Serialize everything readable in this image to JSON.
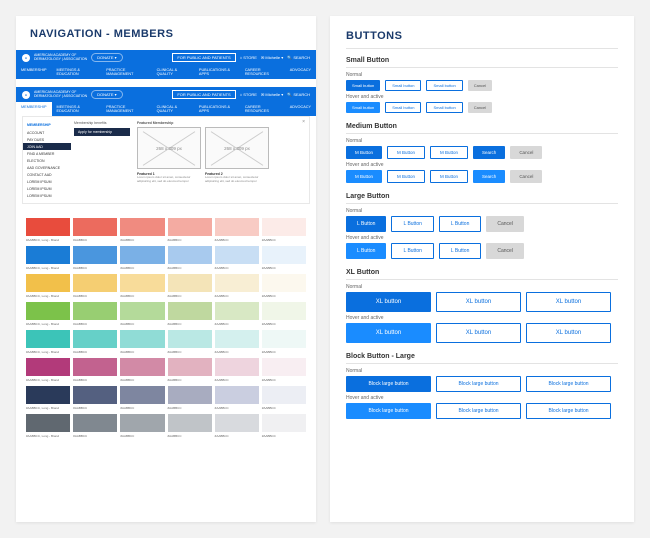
{
  "left_title": "NAVIGATION - MEMBERS",
  "right_title": "BUTTONS",
  "nav": {
    "brand1": "AMERICAN ACADEMY OF",
    "brand2": "DERMATOLOGY | ASSOCIATION",
    "donate": "DONATE ▾",
    "public": "FOR PUBLIC AND PATIENTS",
    "store": "⌂ STORE",
    "member": "✉ Michelle ▾",
    "search": "🔍 SEARCH",
    "items": [
      "MEMBERSHIP",
      "MEETINGS & EDUCATION",
      "PRACTICE MANAGEMENT",
      "CLINICAL & QUALITY",
      "PUBLICATIONS & APPS",
      "CAREER RESOURCES",
      "ADVOCACY"
    ]
  },
  "mega": {
    "header": "MEMBERSHIP",
    "items": [
      "ACCOUNT",
      "PAY DUES",
      "JOIN AAD",
      "FIND A MEMBER",
      "ELECTION",
      "AAD GOVERNANCE",
      "CONTACT AAD",
      "LOREM IPSUM",
      "LOREM IPSUM",
      "LOREM IPSUM"
    ],
    "benefits": "Membership benefits",
    "apply": "Apply for membership",
    "featured": "Featured Membership",
    "size": "268 x 309 px",
    "f1h": "Featured 1",
    "f2h": "Featured 2",
    "lorem": "Lorem ipsum dolor sit amet, consectetur adipisicing elit, sed do eiusmod tempor"
  },
  "swatches": [
    [
      "#e84c3d",
      "#ec6b5e",
      "#f08b80",
      "#f4aba2",
      "#f8cbc4",
      "#fcebe8"
    ],
    [
      "#1a7cd6",
      "#4a96de",
      "#7ab0e6",
      "#a8caee",
      "#c8def4",
      "#e8f2fb"
    ],
    [
      "#f2c04a",
      "#f5ce72",
      "#f8dc9a",
      "#f4e4b8",
      "#f8eed4",
      "#fcf8ee"
    ],
    [
      "#7cc24a",
      "#98ce72",
      "#b4da9a",
      "#bfd89f",
      "#d8e8c4",
      "#f0f6e8"
    ],
    [
      "#3cc4b8",
      "#66d0c8",
      "#90dcd6",
      "#bae8e4",
      "#d4f0ee",
      "#eef8f6"
    ],
    [
      "#b23a7a",
      "#c2628f",
      "#d28aa6",
      "#e2b2c0",
      "#eed4de",
      "#f8eef2"
    ],
    [
      "#2a3a5a",
      "#546080",
      "#7e86a0",
      "#a8acc0",
      "#cacee0",
      "#eceef4"
    ],
    [
      "#606870",
      "#808890",
      "#a0a6ac",
      "#c0c4c8",
      "#d8dade",
      "#f0f0f2"
    ]
  ],
  "swatch_labels": [
    "#AABBCC, Long - Brand",
    "#AABBCC",
    "#AABBCC",
    "#AABBCC",
    "#AABBCC",
    "#AABBCC"
  ],
  "buttons": {
    "sections": [
      {
        "name": "Small Button",
        "size": "sm",
        "label": "Small button",
        "cancel": "Cancel"
      },
      {
        "name": "Medium Button",
        "size": "md",
        "label": "M Button",
        "search": "Search",
        "cancel": "Cancel"
      },
      {
        "name": "Large Button",
        "size": "lg",
        "label": "L Button",
        "cancel": "Cancel"
      },
      {
        "name": "XL Button",
        "size": "xl",
        "label": "XL button"
      },
      {
        "name": "Block Button - Large",
        "size": "block",
        "label": "Block large button"
      }
    ],
    "normal": "Normal",
    "hover": "Hover and active"
  }
}
